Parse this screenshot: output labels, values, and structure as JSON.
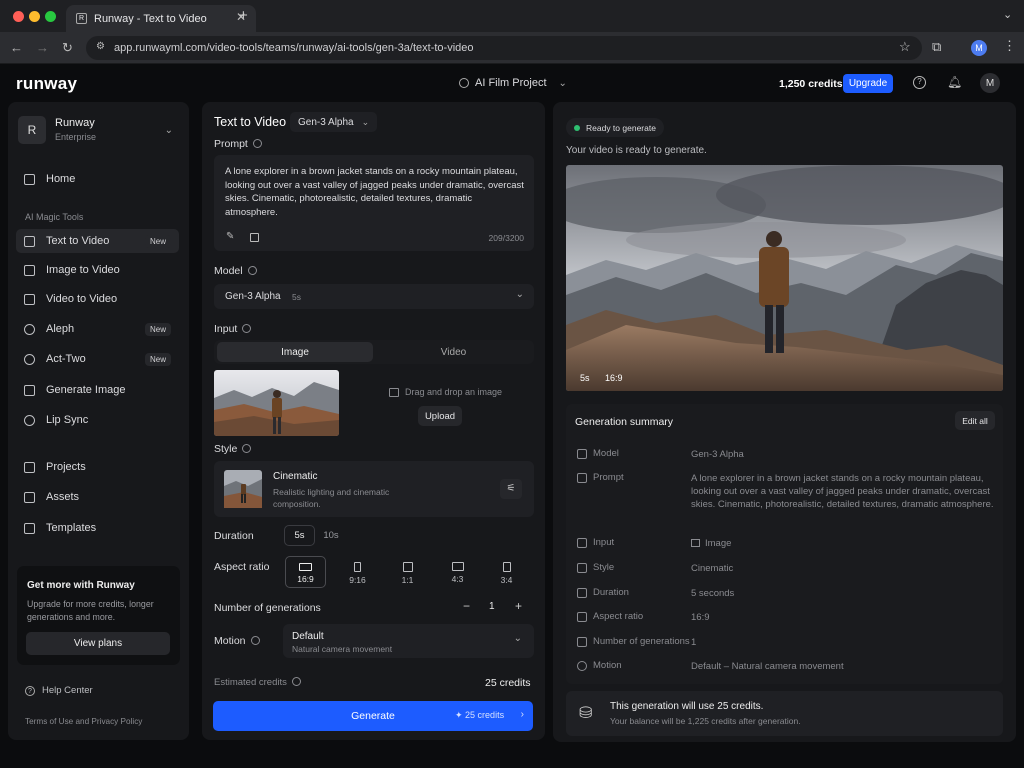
{
  "browser": {
    "tab_title": "Runway - Text to Video",
    "new_tab": "+",
    "url": "app.runwayml.com/video-tools/teams/runway/ai-tools/gen-3a/text-to-video",
    "profile_initial": "M"
  },
  "header": {
    "logo": "runway",
    "project": "AI Film Project",
    "credits": "1,250 credits",
    "upgrade": "Upgrade",
    "avatar": "M"
  },
  "sidebar": {
    "workspace_initial": "R",
    "workspace_name": "Runway",
    "workspace_plan": "Enterprise",
    "home": "Home",
    "section": "AI Magic Tools",
    "tools": [
      {
        "label": "Text to Video",
        "badge": "New"
      },
      {
        "label": "Image to Video"
      },
      {
        "label": "Video to Video"
      },
      {
        "label": "Aleph",
        "badge": "New"
      },
      {
        "label": "Act-Two",
        "badge": "New"
      },
      {
        "label": "Generate Image"
      },
      {
        "label": "Lip Sync"
      }
    ],
    "library": [
      "Projects",
      "Assets",
      "Templates"
    ],
    "promo_title": "Get more with Runway",
    "promo_text": "Upgrade for more credits, longer generations and more.",
    "promo_button": "View plans",
    "help": "Help Center",
    "terms": "Terms of Use and Privacy Policy"
  },
  "form": {
    "title": "Text to Video",
    "model_chip": "Gen-3 Alpha",
    "prompt_label": "Prompt",
    "prompt_text": "A lone explorer in a brown jacket stands on a rocky mountain plateau, looking out over a vast valley of jagged peaks under dramatic, overcast skies. Cinematic, photorealistic, detailed textures, dramatic atmosphere.",
    "char_count": "209/3200",
    "model_label": "Model",
    "model_value": "Gen-3 Alpha",
    "model_duration": "5s",
    "input_label": "Input",
    "input_tabs": [
      "Image",
      "Video"
    ],
    "drag_text": "Drag and drop an image",
    "upload": "Upload",
    "style_label": "Style",
    "style_name": "Cinematic",
    "style_desc": "Realistic lighting and cinematic composition.",
    "duration_label": "Duration",
    "durations": [
      "5s",
      "10s"
    ],
    "aspect_label": "Aspect ratio",
    "aspects": [
      "16:9",
      "9:16",
      "1:1",
      "4:3",
      "3:4"
    ],
    "generations_label": "Number of generations",
    "generations_minus": "−",
    "generations_value": "1",
    "generations_plus": "+",
    "motion_label": "Motion",
    "motion_value": "Default",
    "motion_desc": "Natural camera movement",
    "estimated_label": "Estimated credits",
    "estimated_value": "25 credits",
    "generate": "Generate",
    "generate_credits": "25 credits"
  },
  "preview": {
    "status": "Ready to generate",
    "ready_text": "Your video is ready to generate.",
    "overlay_duration": "5s",
    "overlay_ratio": "16:9",
    "summary_title": "Generation summary",
    "edit_all": "Edit all",
    "rows": [
      {
        "k": "Model",
        "v": "Gen-3 Alpha"
      },
      {
        "k": "Prompt",
        "v": "A lone explorer in a brown jacket stands on a rocky mountain plateau, looking out over a vast valley of jagged peaks under dramatic, overcast skies. Cinematic, photorealistic, detailed textures, dramatic atmosphere."
      },
      {
        "k": "Input",
        "v": "Image"
      },
      {
        "k": "Style",
        "v": "Cinematic"
      },
      {
        "k": "Duration",
        "v": "5 seconds"
      },
      {
        "k": "Aspect ratio",
        "v": "16:9"
      },
      {
        "k": "Number of generations",
        "v": "1"
      },
      {
        "k": "Motion",
        "v": "Default – Natural camera movement"
      }
    ],
    "usage_title": "This generation will use 25 credits.",
    "usage_sub": "Your balance will be 1,225 credits after generation."
  },
  "colors": {
    "accent": "#1d5cff",
    "status_green": "#2fbf71"
  }
}
